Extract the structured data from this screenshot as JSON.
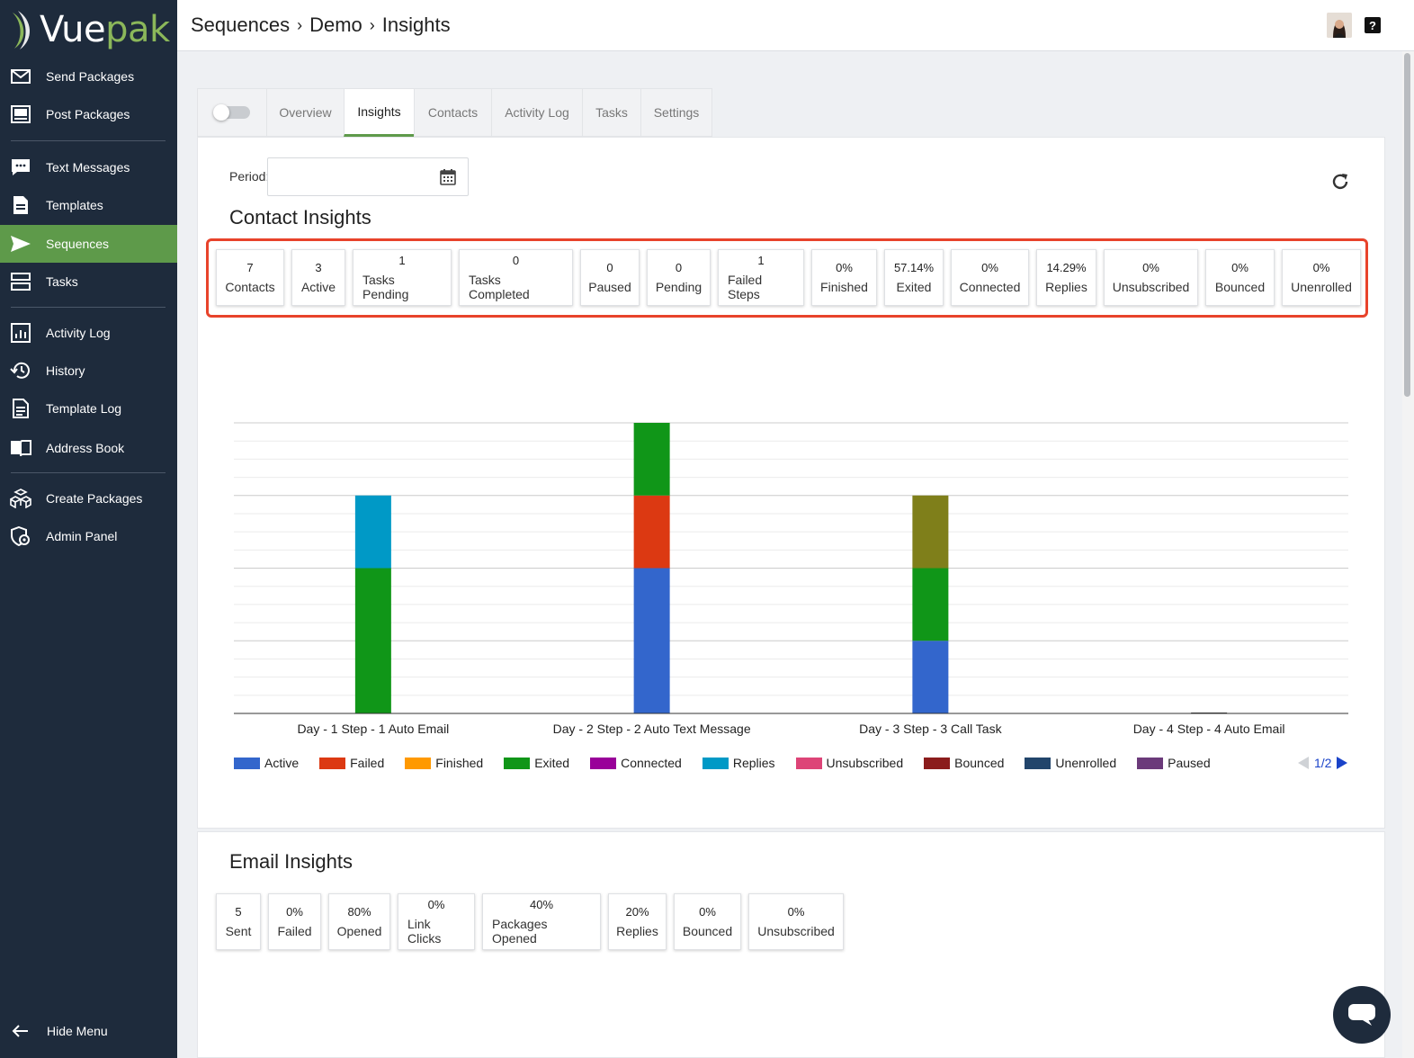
{
  "brand": {
    "name_part1": "Vue",
    "name_part2": "pak"
  },
  "sidebar": {
    "items": [
      {
        "label": "Send Packages",
        "icon": "envelope-icon"
      },
      {
        "label": "Post Packages",
        "icon": "monitor-icon"
      },
      {
        "label": "Text Messages",
        "icon": "chat-bubble-icon"
      },
      {
        "label": "Templates",
        "icon": "document-icon"
      },
      {
        "label": "Sequences",
        "icon": "send-arrow-icon",
        "active": true
      },
      {
        "label": "Tasks",
        "icon": "tasks-list-icon"
      },
      {
        "label": "Activity Log",
        "icon": "bar-chart-icon"
      },
      {
        "label": "History",
        "icon": "history-icon"
      },
      {
        "label": "Template Log",
        "icon": "document-lines-icon"
      },
      {
        "label": "Address Book",
        "icon": "book-icon"
      },
      {
        "label": "Create Packages",
        "icon": "boxes-icon"
      },
      {
        "label": "Admin Panel",
        "icon": "admin-icon"
      }
    ],
    "hide_menu": "Hide Menu"
  },
  "header": {
    "breadcrumb": [
      "Sequences",
      "Demo",
      "Insights"
    ]
  },
  "tabs": [
    "Overview",
    "Insights",
    "Contacts",
    "Activity Log",
    "Tasks",
    "Settings"
  ],
  "active_tab": "Insights",
  "period": {
    "label": "Period:",
    "value": ""
  },
  "contact_insights": {
    "title": "Contact Insights",
    "stats": [
      {
        "value": "7",
        "label": "Contacts"
      },
      {
        "value": "3",
        "label": "Active"
      },
      {
        "value": "1",
        "label": "Tasks Pending"
      },
      {
        "value": "0",
        "label": "Tasks Completed"
      },
      {
        "value": "0",
        "label": "Paused"
      },
      {
        "value": "0",
        "label": "Pending"
      },
      {
        "value": "1",
        "label": "Failed Steps"
      },
      {
        "value": "0%",
        "label": "Finished"
      },
      {
        "value": "57.14%",
        "label": "Exited"
      },
      {
        "value": "0%",
        "label": "Connected"
      },
      {
        "value": "14.29%",
        "label": "Replies"
      },
      {
        "value": "0%",
        "label": "Unsubscribed"
      },
      {
        "value": "0%",
        "label": "Bounced"
      },
      {
        "value": "0%",
        "label": "Unenrolled"
      }
    ]
  },
  "chart_data": {
    "type": "bar",
    "stacked": true,
    "categories": [
      "Day - 1 Step - 1 Auto Email",
      "Day - 2 Step - 2 Auto Text Message",
      "Day - 3 Step - 3 Call Task",
      "Day - 4 Step - 4 Auto Email"
    ],
    "ylim": [
      0,
      4
    ],
    "grid": true,
    "series": [
      {
        "name": "Active",
        "color": "#3366cc",
        "values": [
          0,
          2,
          1,
          0
        ]
      },
      {
        "name": "Failed",
        "color": "#dc3912",
        "values": [
          0,
          1,
          0,
          0
        ]
      },
      {
        "name": "Exited",
        "color": "#109618",
        "values": [
          2,
          1,
          1,
          0
        ]
      },
      {
        "name": "Replies",
        "color": "#0099c6",
        "values": [
          1,
          0,
          0,
          0
        ]
      },
      {
        "color": "#7f7f1a",
        "values": [
          0,
          0,
          1,
          0
        ]
      }
    ],
    "legend": {
      "placement": "bottom",
      "entries": [
        {
          "name": "Active",
          "color": "#3366cc"
        },
        {
          "name": "Failed",
          "color": "#dc3912"
        },
        {
          "name": "Finished",
          "color": "#ff9900"
        },
        {
          "name": "Exited",
          "color": "#109618"
        },
        {
          "name": "Connected",
          "color": "#990099"
        },
        {
          "name": "Replies",
          "color": "#0099c6"
        },
        {
          "name": "Unsubscribed",
          "color": "#dd4477"
        },
        {
          "name": "Bounced",
          "color": "#8b1c1c"
        },
        {
          "name": "Unenrolled",
          "color": "#22456b"
        },
        {
          "name": "Paused",
          "color": "#6b3a7a"
        }
      ],
      "page": "1/2"
    }
  },
  "email_insights": {
    "title": "Email Insights",
    "stats": [
      {
        "value": "5",
        "label": "Sent"
      },
      {
        "value": "0%",
        "label": "Failed"
      },
      {
        "value": "80%",
        "label": "Opened"
      },
      {
        "value": "0%",
        "label": "Link Clicks"
      },
      {
        "value": "40%",
        "label": "Packages Opened"
      },
      {
        "value": "20%",
        "label": "Replies"
      },
      {
        "value": "0%",
        "label": "Bounced"
      },
      {
        "value": "0%",
        "label": "Unsubscribed"
      }
    ]
  },
  "colors": {
    "sidebar_bg": "#1e2b3c",
    "accent_green": "#5e9a4a",
    "highlight_red": "#e8432b"
  }
}
